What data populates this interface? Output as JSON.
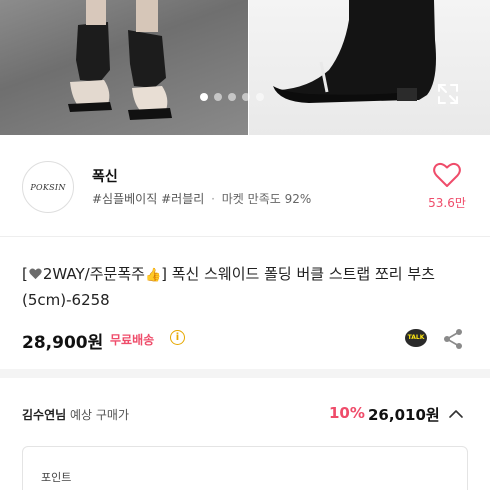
{
  "carousel": {
    "total": 5,
    "active_index": 0
  },
  "seller": {
    "logo_text": "POKSIN",
    "name": "폭신",
    "tags": [
      "#심플베이직",
      "#러블리"
    ],
    "satisfaction": "마켓 만족도 92%",
    "likes": "53.6만"
  },
  "product": {
    "title_prefix": "[",
    "title_mid": "2WAY/주문폭주",
    "title_rest": "] 폭신 스웨이드 폴딩 버클 스트랩 쪼리 부츠(5cm)-6258",
    "price": "28,900원",
    "shipping": "무료배송",
    "info_glyph": "i",
    "talk_label": "TALK"
  },
  "expected": {
    "buyer_name": "김수연님",
    "label": "예상 구매가",
    "discount": "10%",
    "final_price": "26,010원"
  },
  "points": {
    "label": "포인트"
  },
  "colors": {
    "accent": "#ef4c6a",
    "info": "#e6a800",
    "talk_bg": "#2a2a2a",
    "talk_fg": "#ffe812"
  },
  "icons": [
    "heart-outline-icon",
    "info-icon",
    "talk-icon",
    "share-icon",
    "chevron-up-icon",
    "expand-icon"
  ]
}
